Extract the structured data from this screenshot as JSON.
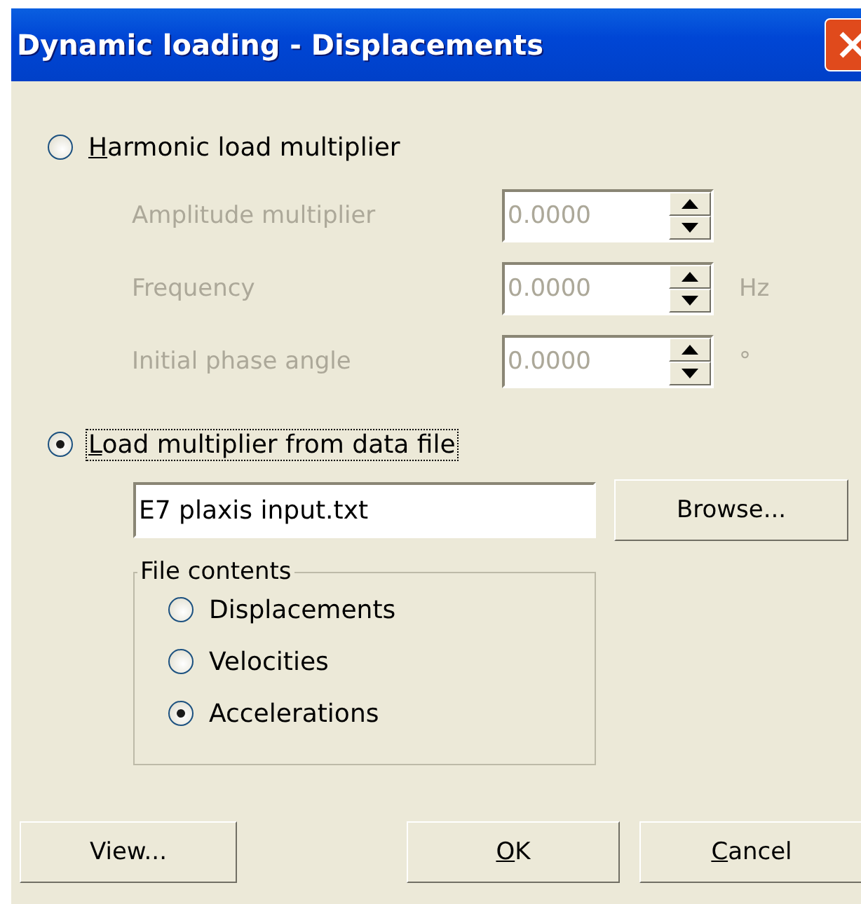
{
  "window": {
    "title": "Dynamic loading - Displacements"
  },
  "modes": [
    {
      "label": "Harmonic load multiplier",
      "mnemonic": true,
      "selected": false,
      "focused": false
    },
    {
      "label": "Load multiplier from data file",
      "mnemonic": true,
      "selected": true,
      "focused": true
    }
  ],
  "harmonic_fields": [
    {
      "label": "Amplitude multiplier",
      "value": "0.0000",
      "disabled": true
    },
    {
      "label": "Frequency",
      "value": "0.0000",
      "unit": "Hz",
      "disabled": true
    },
    {
      "label": "Initial phase angle",
      "value": "0.0000",
      "unit": "°",
      "disabled": true
    }
  ],
  "data_file": {
    "value": "E7 plaxis input.txt",
    "browse_button": "Browse..."
  },
  "file_contents": {
    "title": "File contents",
    "options": [
      {
        "label": "Displacements",
        "selected": false
      },
      {
        "label": "Velocities",
        "selected": false
      },
      {
        "label": "Accelerations",
        "selected": true
      }
    ]
  },
  "buttons": [
    {
      "label": "View...",
      "mnemonic": false
    },
    {
      "label": "OK",
      "mnemonic": true
    },
    {
      "label": "Cancel",
      "mnemonic": true
    }
  ]
}
